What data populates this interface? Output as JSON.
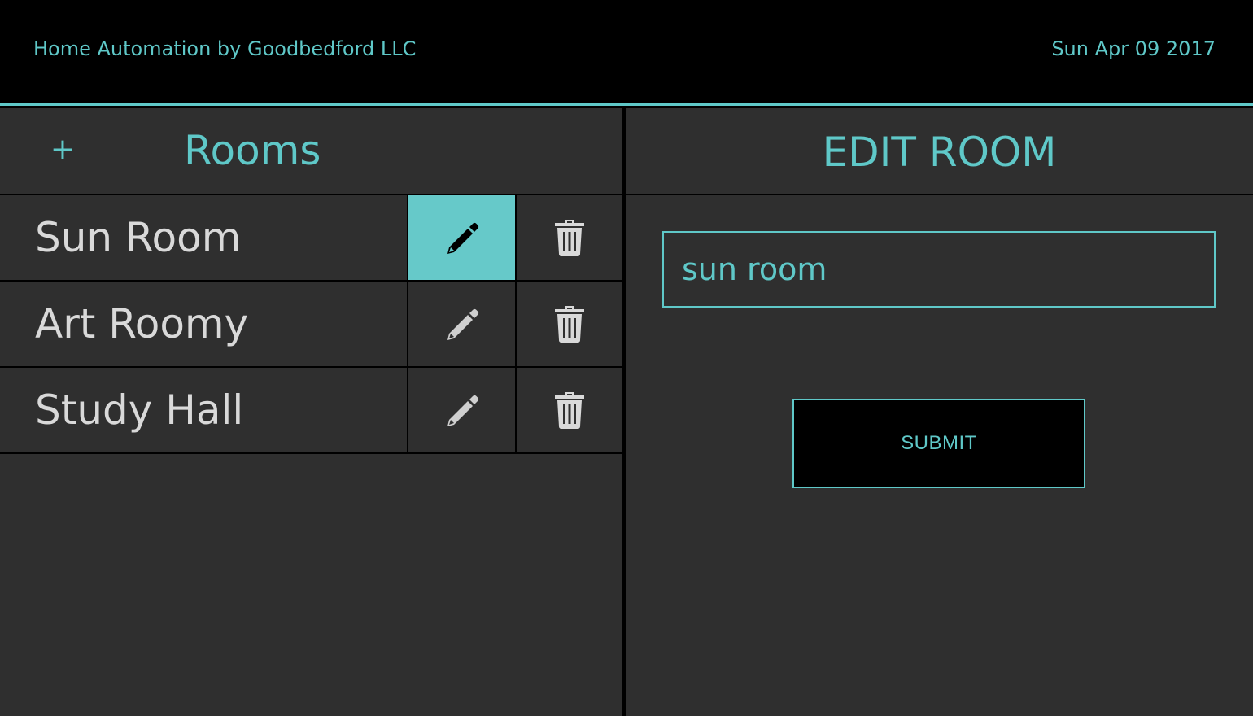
{
  "header": {
    "title": "Home Automation by Goodbedford LLC",
    "date": "Sun Apr 09 2017"
  },
  "rooms_panel": {
    "add_label": "+",
    "title": "Rooms",
    "rooms": [
      {
        "name": "Sun Room",
        "edit_icon": "pencil-icon",
        "delete_icon": "trash-icon",
        "selected": true
      },
      {
        "name": "Art Roomy",
        "edit_icon": "pencil-icon",
        "delete_icon": "trash-icon",
        "selected": false
      },
      {
        "name": "Study Hall",
        "edit_icon": "pencil-icon",
        "delete_icon": "trash-icon",
        "selected": false
      }
    ]
  },
  "edit_panel": {
    "title": "EDIT ROOM",
    "input_value": "sun room",
    "submit_label": "SUBMIT"
  },
  "colors": {
    "accent": "#5fc8c8",
    "panel_background": "#2f2f2f",
    "header_background": "#000000",
    "room_text": "#d9d9d9",
    "selected_edit_background": "#66c9c9"
  }
}
